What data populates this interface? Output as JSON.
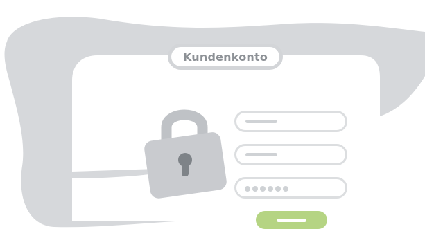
{
  "title": {
    "label": "Kundenkonto"
  },
  "form": {
    "fields": [
      {
        "kind": "text",
        "placeholder": ""
      },
      {
        "kind": "text",
        "placeholder": ""
      },
      {
        "kind": "password",
        "masked_count": 6
      }
    ],
    "submit": {
      "label": ""
    }
  },
  "icons": {
    "lock": "padlock-icon"
  },
  "colors": {
    "blob": "#d6d8db",
    "lock_body": "#c9cbcf",
    "lock_shackle": "#bfc2c6",
    "keyhole": "#7e8388",
    "field_border": "#dcdee0",
    "submit": "#b5d483"
  }
}
